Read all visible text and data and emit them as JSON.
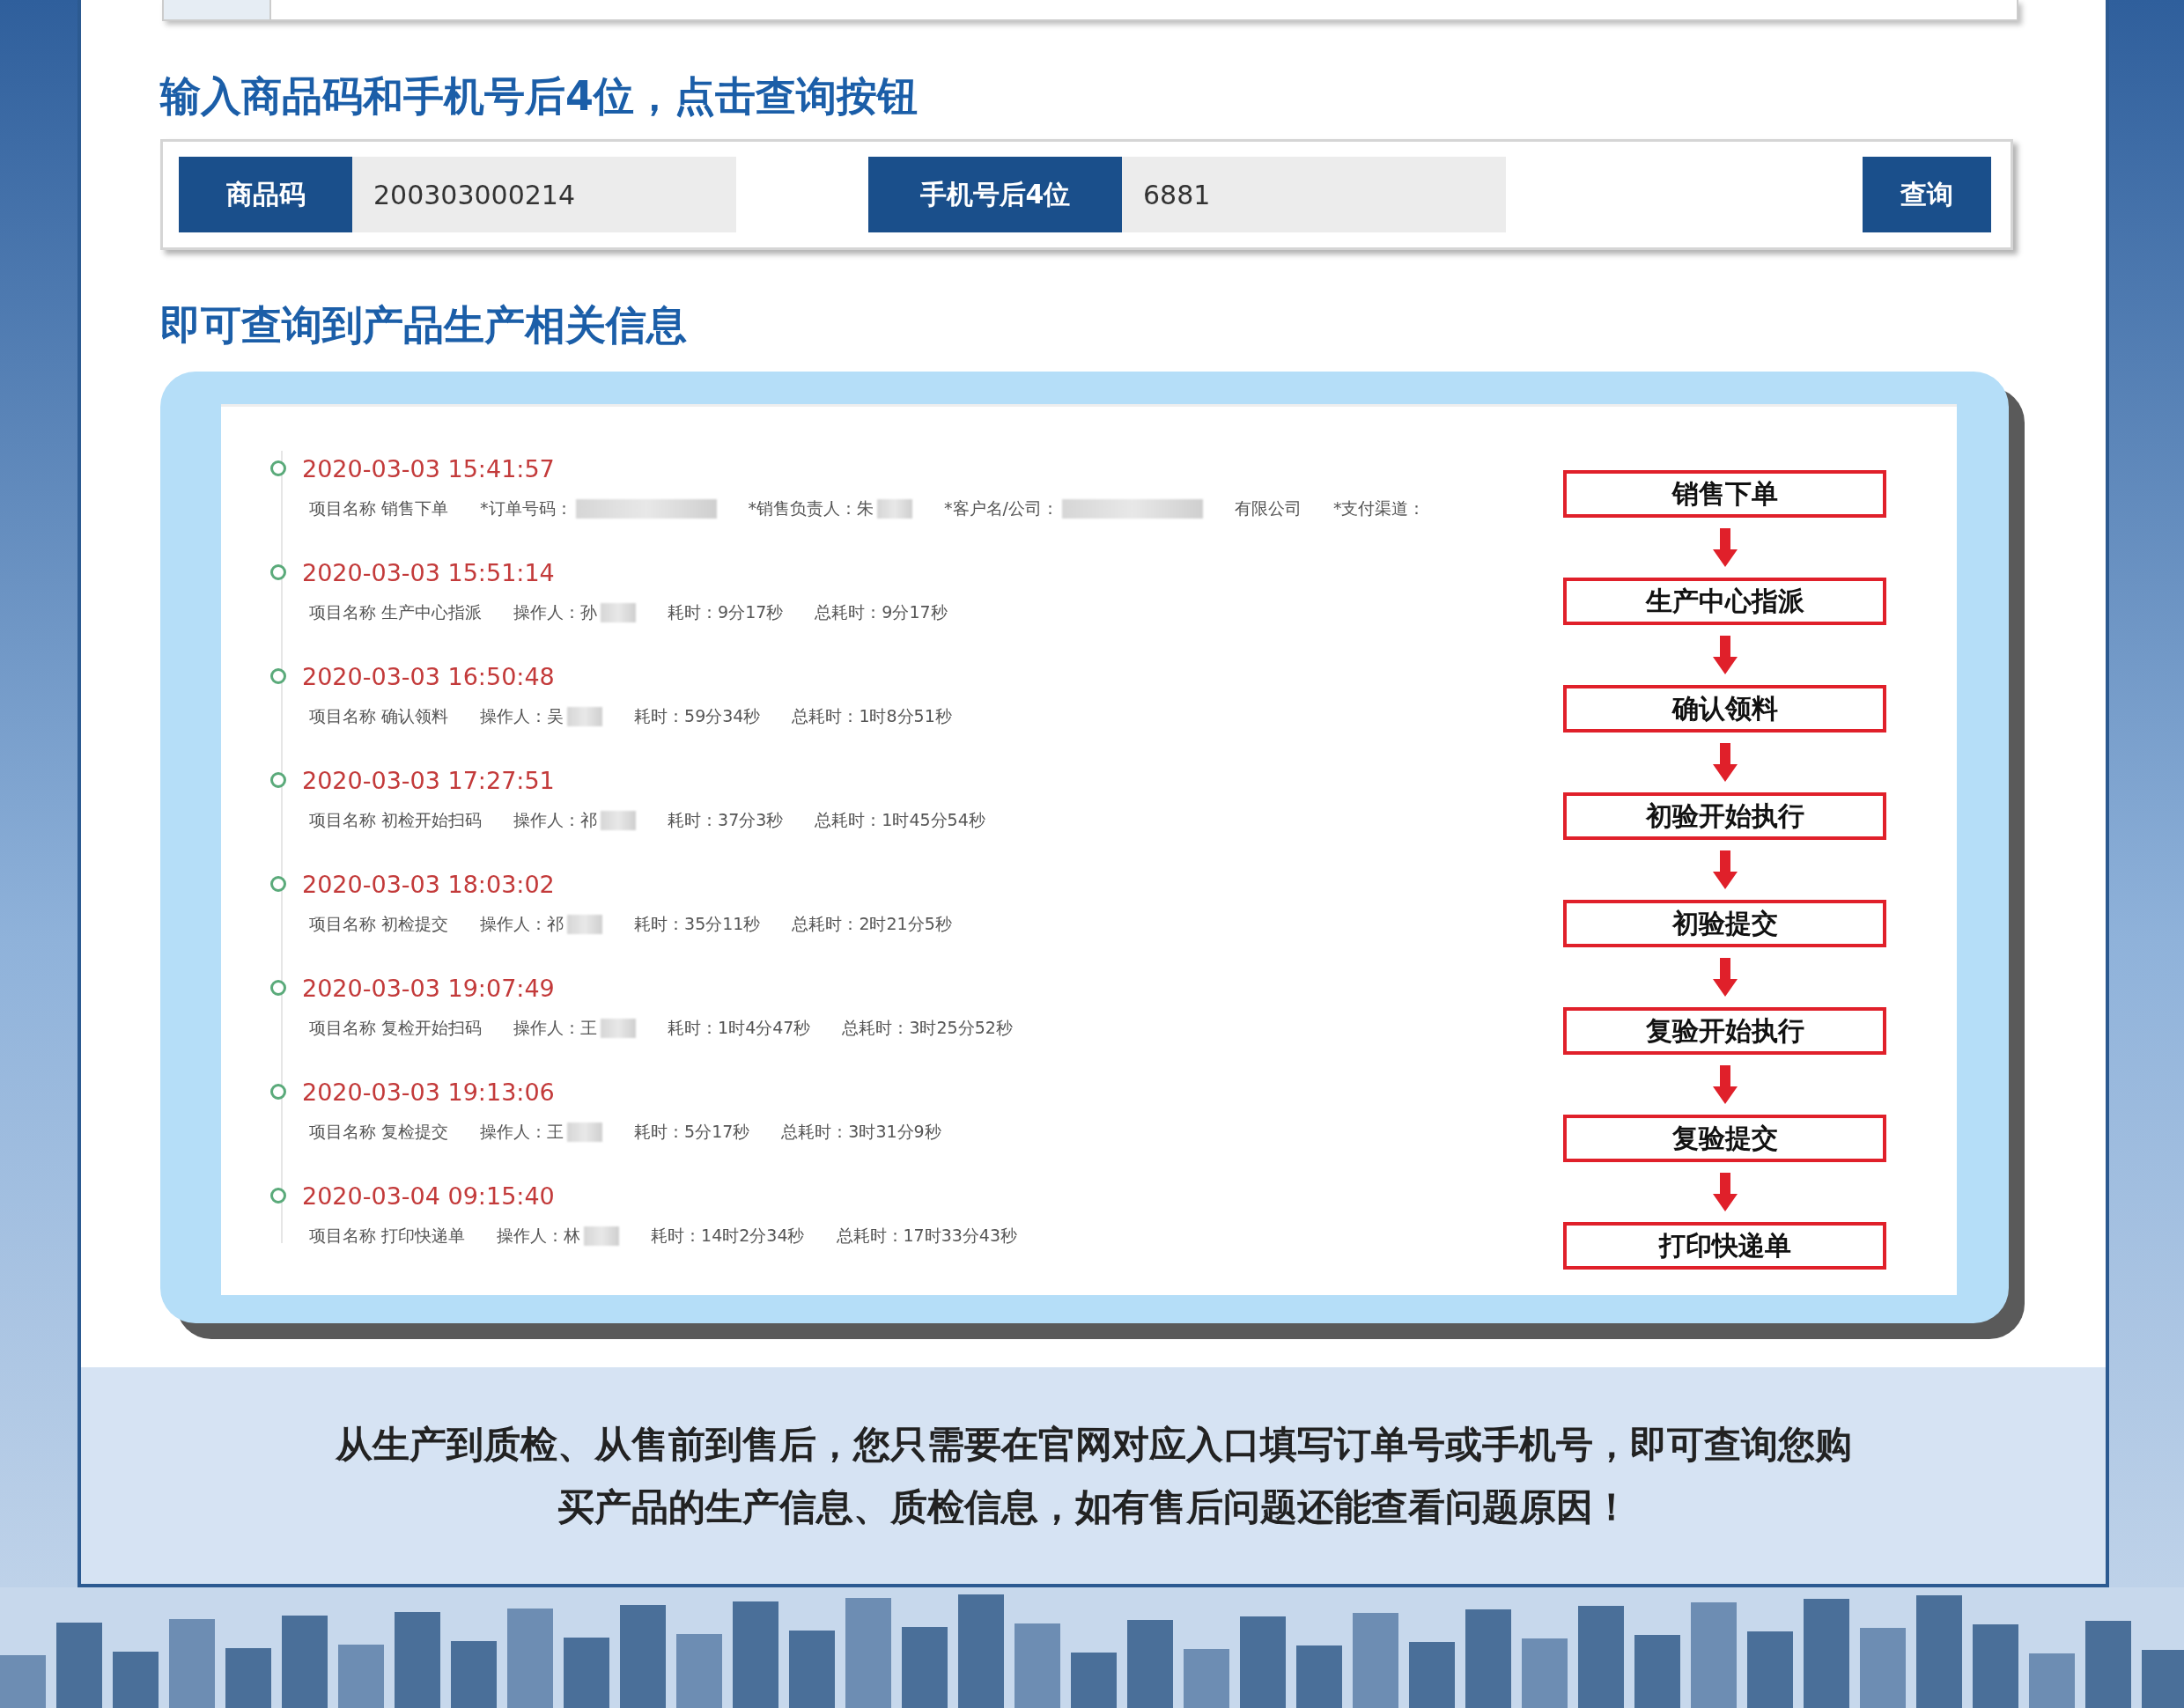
{
  "query_section": {
    "heading": "输入商品码和手机号后4位，点击查询按钮",
    "fields": [
      {
        "label": "商品码",
        "value": "200303000214"
      },
      {
        "label": "手机号后4位",
        "value": "6881"
      }
    ],
    "button": "查询"
  },
  "result_section": {
    "heading": "即可查询到产品生产相关信息",
    "timeline": [
      {
        "time": "2020-03-03 15:41:57",
        "details": [
          {
            "text": "项目名称 销售下单"
          },
          {
            "text": "*订单号码：",
            "redacted": true
          },
          {
            "text": "*销售负责人：朱",
            "redacted": true
          },
          {
            "text": "*客户名/公司：",
            "redacted": true
          },
          {
            "text": "有限公司"
          },
          {
            "text": "*支付渠道："
          }
        ]
      },
      {
        "time": "2020-03-03 15:51:14",
        "details": [
          {
            "text": "项目名称 生产中心指派"
          },
          {
            "text": "操作人：孙",
            "redacted": true
          },
          {
            "text": "耗时：9分17秒"
          },
          {
            "text": "总耗时：9分17秒"
          }
        ]
      },
      {
        "time": "2020-03-03 16:50:48",
        "details": [
          {
            "text": "项目名称 确认领料"
          },
          {
            "text": "操作人：吴",
            "redacted": true
          },
          {
            "text": "耗时：59分34秒"
          },
          {
            "text": "总耗时：1时8分51秒"
          }
        ]
      },
      {
        "time": "2020-03-03 17:27:51",
        "details": [
          {
            "text": "项目名称 初检开始扫码"
          },
          {
            "text": "操作人：祁",
            "redacted": true
          },
          {
            "text": "耗时：37分3秒"
          },
          {
            "text": "总耗时：1时45分54秒"
          }
        ]
      },
      {
        "time": "2020-03-03 18:03:02",
        "details": [
          {
            "text": "项目名称 初检提交"
          },
          {
            "text": "操作人：祁",
            "redacted": true
          },
          {
            "text": "耗时：35分11秒"
          },
          {
            "text": "总耗时：2时21分5秒"
          }
        ]
      },
      {
        "time": "2020-03-03 19:07:49",
        "details": [
          {
            "text": "项目名称 复检开始扫码"
          },
          {
            "text": "操作人：王",
            "redacted": true
          },
          {
            "text": "耗时：1时4分47秒"
          },
          {
            "text": "总耗时：3时25分52秒"
          }
        ]
      },
      {
        "time": "2020-03-03 19:13:06",
        "details": [
          {
            "text": "项目名称 复检提交"
          },
          {
            "text": "操作人：王",
            "redacted": true
          },
          {
            "text": "耗时：5分17秒"
          },
          {
            "text": "总耗时：3时31分9秒"
          }
        ]
      },
      {
        "time": "2020-03-04 09:15:40",
        "details": [
          {
            "text": "项目名称 打印快递单"
          },
          {
            "text": "操作人：林",
            "redacted": true
          },
          {
            "text": "耗时：14时2分34秒"
          },
          {
            "text": "总耗时：17时33分43秒"
          }
        ]
      }
    ],
    "flow_steps": [
      "销售下单",
      "生产中心指派",
      "确认领料",
      "初验开始执行",
      "初验提交",
      "复验开始执行",
      "复验提交",
      "打印快递单"
    ]
  },
  "footer": {
    "lines": [
      "从生产到质检、从售前到售后，您只需要在官网对应入口填写订单号或手机号，即可查询您购",
      "买产品的生产信息、质检信息，如有售后问题还能查看问题原因！"
    ]
  }
}
